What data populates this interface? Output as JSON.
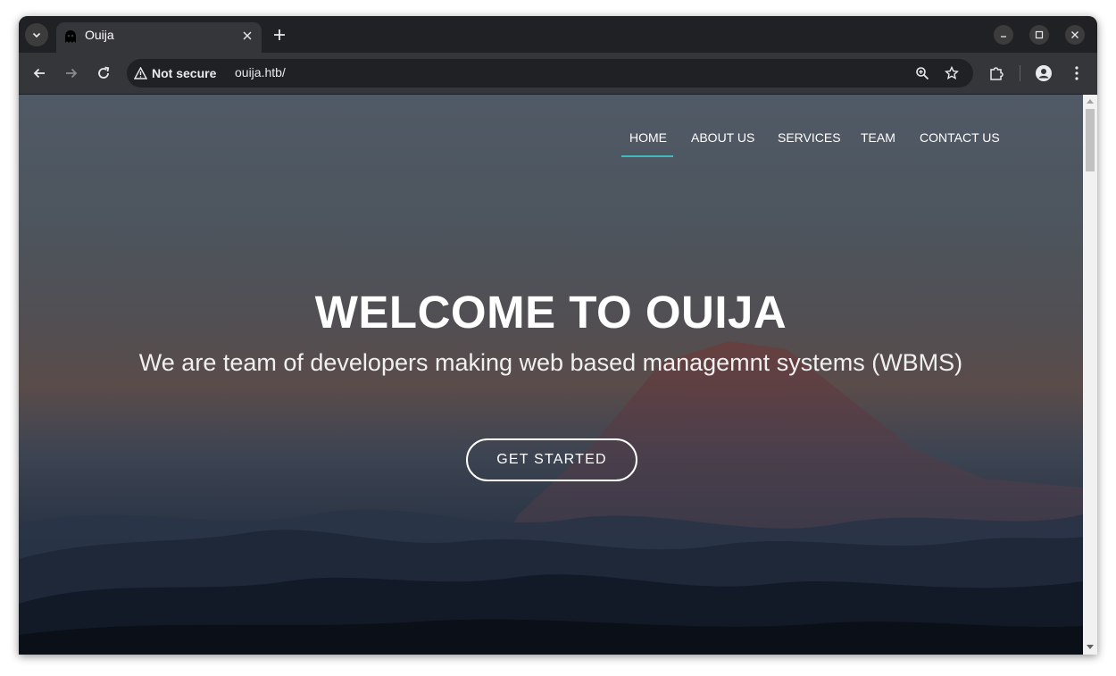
{
  "browser": {
    "tab_title": "Ouija",
    "security_label": "Not secure",
    "url": "ouija.htb/"
  },
  "nav": {
    "items": [
      {
        "label": "HOME",
        "active": true
      },
      {
        "label": "ABOUT US",
        "active": false
      },
      {
        "label": "SERVICES",
        "active": false
      },
      {
        "label": "TEAM",
        "active": false
      },
      {
        "label": "CONTACT US",
        "active": false
      }
    ]
  },
  "hero": {
    "title": "WELCOME TO OUIJA",
    "subtitle": "We are team of developers making web based managemnt systems (WBMS)",
    "cta_label": "GET STARTED"
  },
  "colors": {
    "accent": "#3fbbc0",
    "chrome_dark": "#202124",
    "chrome_tab": "#35363a"
  }
}
